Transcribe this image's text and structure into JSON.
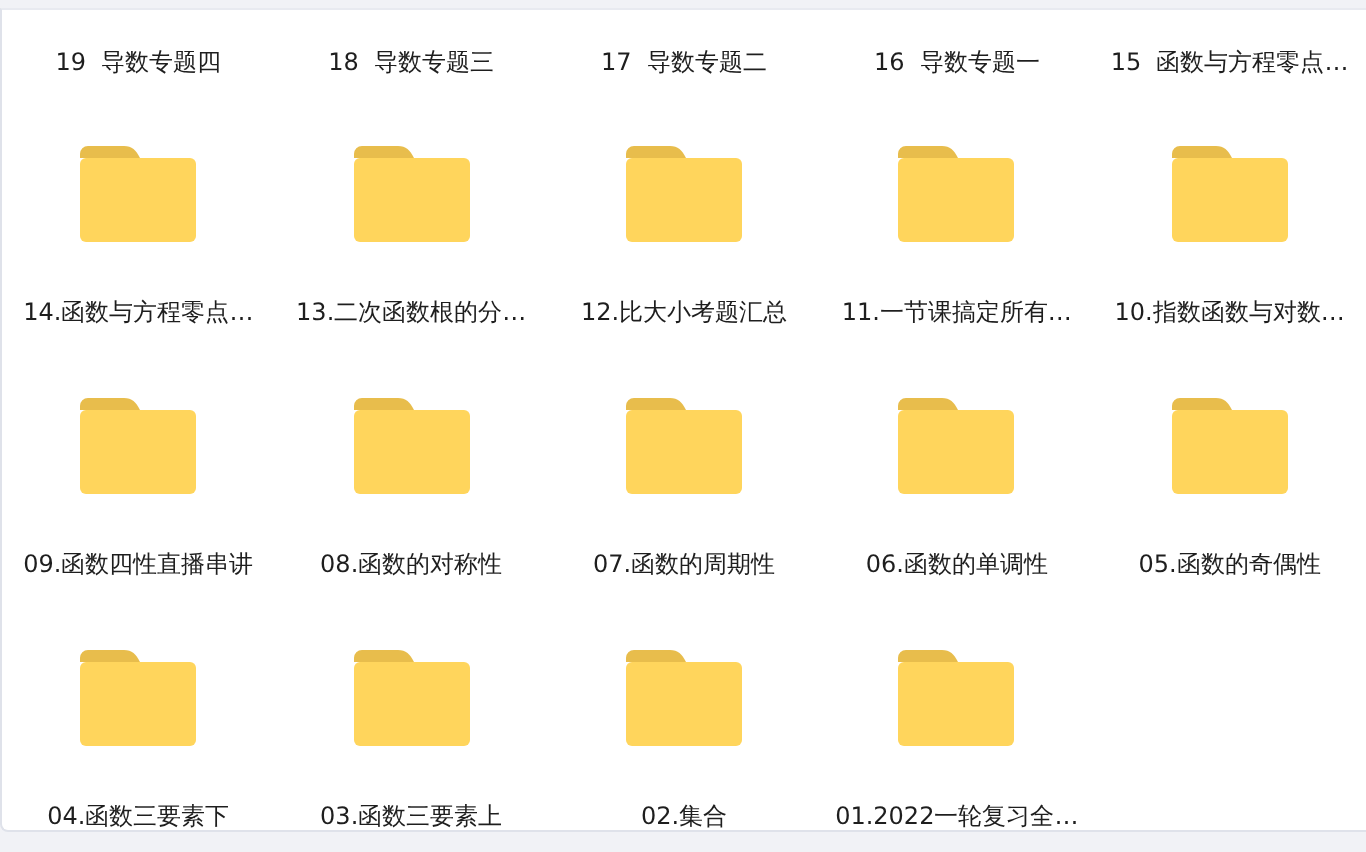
{
  "items": [
    {
      "kind": "label_only",
      "label": "19  导数专题四"
    },
    {
      "kind": "label_only",
      "label": "18  导数专题三"
    },
    {
      "kind": "label_only",
      "label": "17  导数专题二"
    },
    {
      "kind": "label_only",
      "label": "16  导数专题一"
    },
    {
      "kind": "label_only",
      "label": "15  函数与方程零点…"
    },
    {
      "kind": "folder",
      "label": "14.函数与方程零点…"
    },
    {
      "kind": "folder",
      "label": "13.二次函数根的分…"
    },
    {
      "kind": "folder",
      "label": "12.比大小考题汇总"
    },
    {
      "kind": "folder",
      "label": "11.一节课搞定所有…"
    },
    {
      "kind": "folder",
      "label": "10.指数函数与对数…"
    },
    {
      "kind": "folder",
      "label": "09.函数四性直播串讲"
    },
    {
      "kind": "folder",
      "label": "08.函数的对称性"
    },
    {
      "kind": "folder",
      "label": "07.函数的周期性"
    },
    {
      "kind": "folder",
      "label": "06.函数的单调性"
    },
    {
      "kind": "folder",
      "label": "05.函数的奇偶性"
    },
    {
      "kind": "folder",
      "label": "04.函数三要素下"
    },
    {
      "kind": "folder",
      "label": "03.函数三要素上"
    },
    {
      "kind": "folder",
      "label": "02.集合"
    },
    {
      "kind": "folder",
      "label": "01.2022一轮复习全…"
    }
  ]
}
